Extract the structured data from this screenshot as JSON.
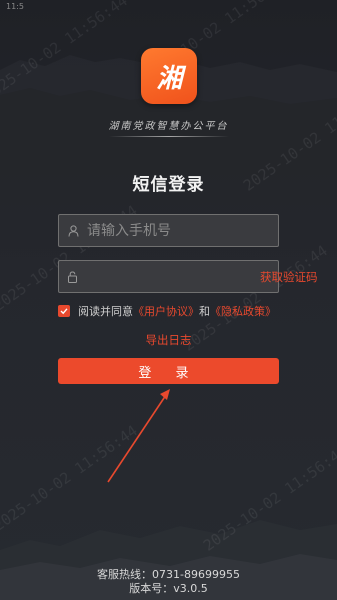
{
  "status_bar": {
    "time": "11:5"
  },
  "app": {
    "logo_text": "湘",
    "subtitle": "湖南党政智慧办公平台"
  },
  "page_title": "短信登录",
  "form": {
    "phone_placeholder": "请输入手机号",
    "code_placeholder": "",
    "get_code_label": "获取验证码"
  },
  "agreement": {
    "prefix": "阅读并同意",
    "user_agreement": "《用户协议》",
    "and": "和",
    "privacy_policy": "《隐私政策》",
    "checked": true
  },
  "export_log_label": "导出日志",
  "login_label": "登 录",
  "footer": {
    "hotline": "客服热线：0731-89699955",
    "version": "版本号：v3.0.5"
  },
  "watermark_text": "2025-10-02 11:56:44",
  "colors": {
    "accent": "#e8492e",
    "background": "#1f2126",
    "field_bg": "#3a3b3f"
  }
}
